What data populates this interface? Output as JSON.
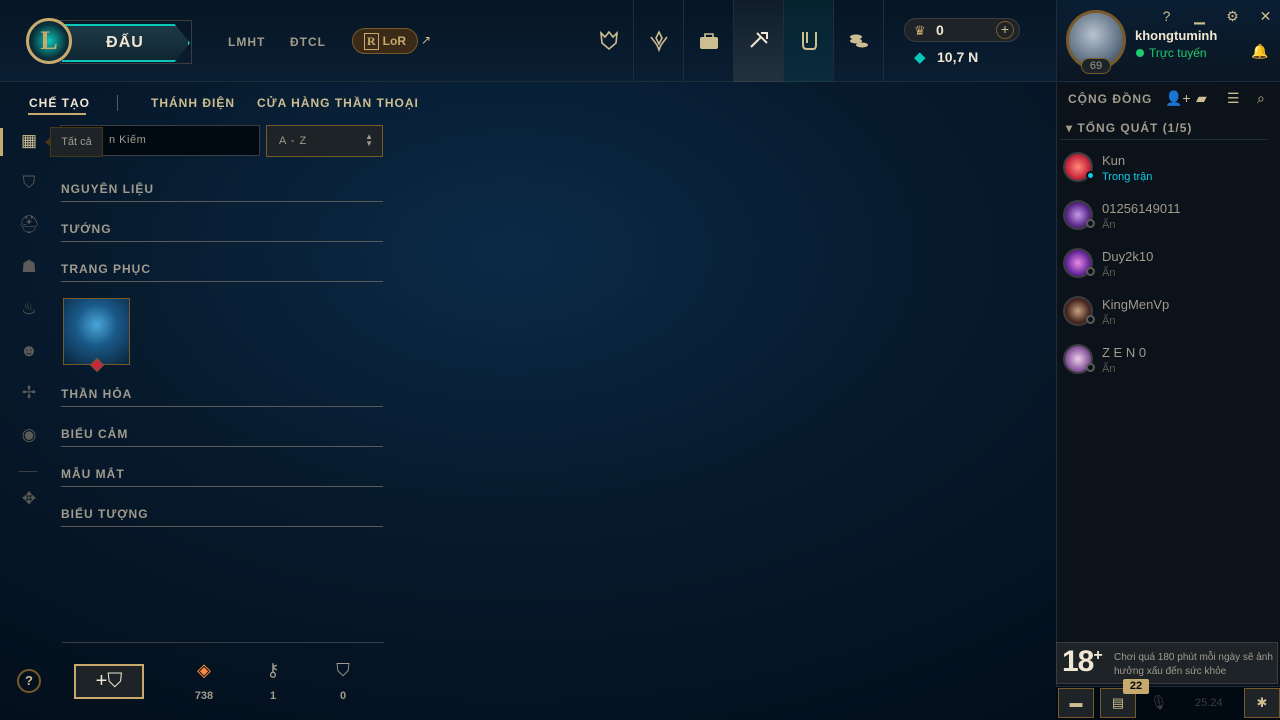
{
  "topbar": {
    "play_label": "ĐẤU",
    "nav": [
      "LMHT",
      "ĐTCL"
    ],
    "lor_label": "LoR",
    "lor_letter": "R",
    "ext_symbol": "↗",
    "nav_icons": [
      "trophy-icon",
      "ranked-icon",
      "collection-icon",
      "crafting-icon",
      "loot-icon",
      "store-icon"
    ],
    "rp_value": "0",
    "be_value": "10,7 N"
  },
  "profile": {
    "username": "khongtuminh",
    "status": "Trực tuyến",
    "level": "69"
  },
  "subnav": {
    "items": [
      "CHẾ TẠO",
      "THÁNH ĐIỆN",
      "CỬA HÀNG THẦN THOẠI"
    ]
  },
  "filters": {
    "tooltip": "Tất cả",
    "search_text": "n Kiếm",
    "sort_value": "A - Z"
  },
  "sections": [
    "NGUYÊN LIỆU",
    "TƯỚNG",
    "TRANG PHỤC",
    "THẦN HỎA",
    "BIỂU CẢM",
    "MẪU MẮT",
    "BIỂU TƯỢNG"
  ],
  "resources": {
    "essence": "738",
    "keys": "1",
    "chests": "0"
  },
  "social": {
    "title": "CỘNG ĐỒNG",
    "group": "TỔNG QUÁT (1/5)",
    "friends": [
      {
        "name": "Kun",
        "status": "Trong trận"
      },
      {
        "name": "01256149011",
        "status": "Ẩn"
      },
      {
        "name": "Duy2k10",
        "status": "Ẩn"
      },
      {
        "name": "KingMenVp",
        "status": "Ẩn"
      },
      {
        "name": "Z E N 0",
        "status": "Ẩn"
      }
    ]
  },
  "warning": {
    "age": "18",
    "plus": "+",
    "text": "Chơi quá 180 phút mỗi ngày sẽ ảnh hưởng xấu đến sức khỏe"
  },
  "footer": {
    "badge_count": "22",
    "version": "25.24"
  },
  "colors": {
    "gold": "#c8aa6e",
    "teal": "#0ac8b9",
    "online": "#1ccd6e",
    "ingame": "#0acbe6"
  }
}
